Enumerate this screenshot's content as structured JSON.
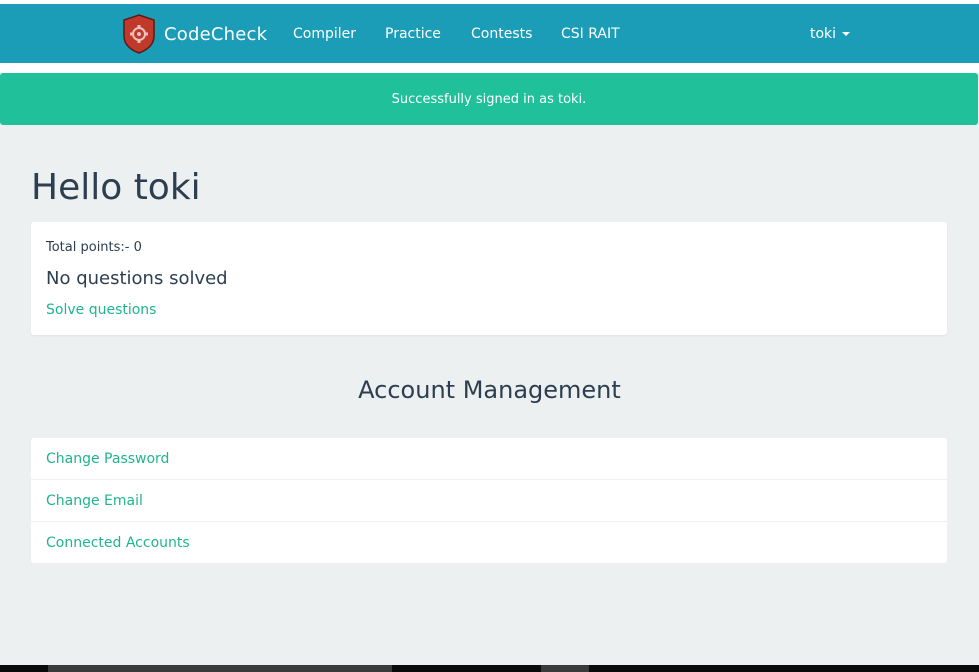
{
  "navbar": {
    "brand": "CodeCheck",
    "links": [
      "Compiler",
      "Practice",
      "Contests",
      "CSI RAIT"
    ],
    "user": "toki",
    "colors": {
      "background": "#1b9db7"
    }
  },
  "alert": {
    "message": "Successfully signed in as toki.",
    "color": "#1fc09a"
  },
  "page": {
    "title": "Hello toki"
  },
  "stats_card": {
    "points": "Total points:- 0",
    "solved": "No questions solved",
    "solve_link": "Solve questions"
  },
  "account": {
    "title": "Account Management",
    "items": [
      "Change Password",
      "Change Email",
      "Connected Accounts"
    ],
    "link_color": "#1fb58f"
  }
}
